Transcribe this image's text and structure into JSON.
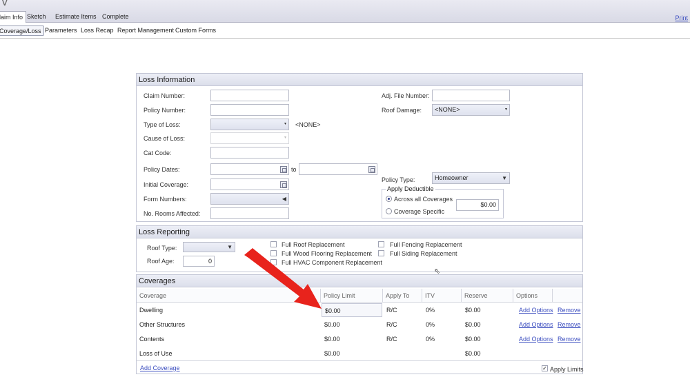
{
  "topbar": {
    "tabs": [
      "laim Info",
      "Sketch",
      "Estimate Items",
      "Complete"
    ],
    "print_label": "Print"
  },
  "subnav": {
    "items": [
      "Coverage/Loss",
      "Parameters",
      "Loss Recap",
      "Report Management",
      "Custom Forms"
    ]
  },
  "loss_info": {
    "title": "Loss Information",
    "claim_number_label": "Claim Number:",
    "policy_number_label": "Policy Number:",
    "type_of_loss_label": "Type of Loss:",
    "type_of_loss_display": "<NONE>",
    "cause_of_loss_label": "Cause of Loss:",
    "cat_code_label": "Cat Code:",
    "policy_dates_label": "Policy Dates:",
    "to_label": "to",
    "initial_coverage_label": "Initial Coverage:",
    "form_numbers_label": "Form Numbers:",
    "rooms_label": "No. Rooms Affected:",
    "adj_file_label": "Adj. File Number:",
    "roof_damage_label": "Roof Damage:",
    "roof_damage_value": "<NONE>",
    "policy_type_label": "Policy Type:",
    "policy_type_value": "Homeowner",
    "deductible_legend": "Apply Deductible",
    "across_all_label": "Across all Coverages",
    "coverage_specific_label": "Coverage Specific",
    "deductible_value": "$0.00"
  },
  "loss_reporting": {
    "title": "Loss Reporting",
    "roof_type_label": "Roof Type:",
    "roof_age_label": "Roof Age:",
    "roof_age_value": "0",
    "checks": [
      "Full Roof Replacement",
      "Full Wood Flooring Replacement",
      "Full HVAC Component Replacement",
      "Full Fencing Replacement",
      "Full Siding Replacement"
    ]
  },
  "coverages": {
    "title": "Coverages",
    "headers": [
      "Coverage",
      "Policy Limit",
      "Apply To",
      "ITV",
      "Reserve",
      "Options"
    ],
    "rows": [
      {
        "name": "Dwelling",
        "limit": "$0.00",
        "apply_to": "R/C",
        "itv": "0%",
        "reserve": "$0.00",
        "add": "Add Options",
        "remove": "Remove"
      },
      {
        "name": "Other Structures",
        "limit": "$0.00",
        "apply_to": "R/C",
        "itv": "0%",
        "reserve": "$0.00",
        "add": "Add Options",
        "remove": "Remove"
      },
      {
        "name": "Contents",
        "limit": "$0.00",
        "apply_to": "R/C",
        "itv": "0%",
        "reserve": "$0.00",
        "add": "Add Options",
        "remove": "Remove"
      },
      {
        "name": "Loss of Use",
        "limit": "$0.00",
        "apply_to": "",
        "itv": "",
        "reserve": "$0.00",
        "add": "",
        "remove": ""
      }
    ],
    "add_coverage_label": "Add Coverage",
    "apply_limits_label": "Apply Limits"
  },
  "colors": {
    "arrow": "#e8231c",
    "link": "#3d4fc0"
  }
}
